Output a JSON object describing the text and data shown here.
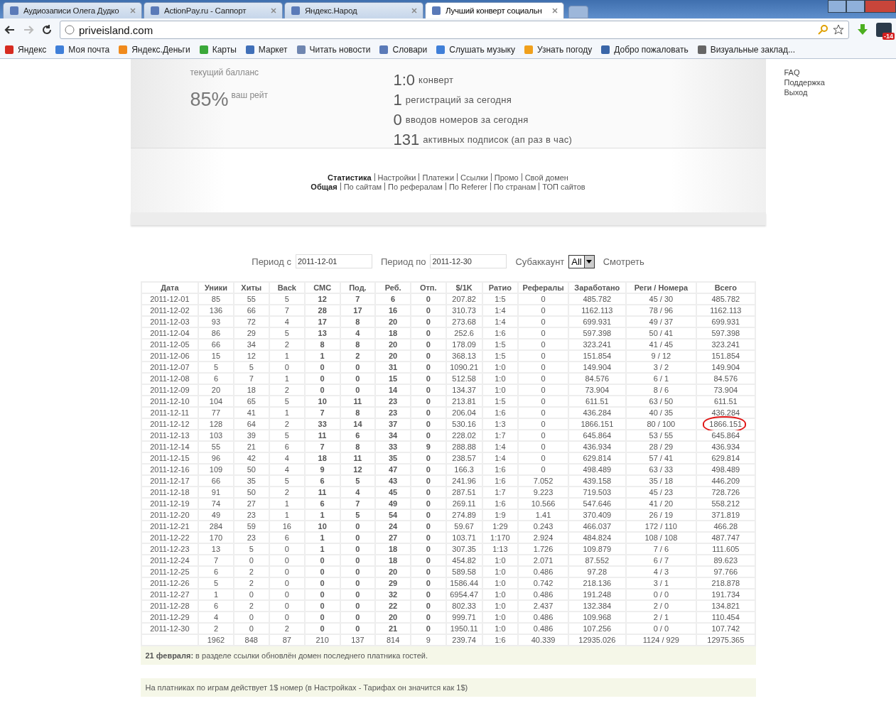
{
  "browser": {
    "tabs": [
      {
        "label": "Аудиозаписи Олега Дудко",
        "selected": false
      },
      {
        "label": "ActionPay.ru - Саппорт",
        "selected": false
      },
      {
        "label": "Яндекс.Народ",
        "selected": false
      },
      {
        "label": "Лучший конверт социальн",
        "selected": true
      }
    ],
    "address": "priveisland.com",
    "badge": "-14",
    "bookmarks": [
      {
        "label": "Яндекс",
        "color": "#d62b20"
      },
      {
        "label": "Моя почта",
        "color": "#3f7fd8"
      },
      {
        "label": "Яндекс.Деньги",
        "color": "#f08a1c"
      },
      {
        "label": "Карты",
        "color": "#3aa83a"
      },
      {
        "label": "Маркет",
        "color": "#3f6fb8"
      },
      {
        "label": "Читать новости",
        "color": "#6f86b0"
      },
      {
        "label": "Словари",
        "color": "#5a7ab8"
      },
      {
        "label": "Слушать музыку",
        "color": "#3f7fd8"
      },
      {
        "label": "Узнать погоду",
        "color": "#f0a01c"
      },
      {
        "label": "Добро пожаловать",
        "color": "#3a66a8"
      },
      {
        "label": "Визуальные заклад...",
        "color": "#666666"
      }
    ]
  },
  "header": {
    "balance_label": "текущий балланс",
    "rate": "85%",
    "rate_label": "ваш рейт",
    "stats": [
      {
        "value": "1:0",
        "label": "конверт"
      },
      {
        "value": "1",
        "label": "регистраций за сегодня"
      },
      {
        "value": "0",
        "label": "вводов номеров за сегодня"
      },
      {
        "value": "131",
        "label": "активных подписок (ап раз в час)"
      }
    ],
    "links": [
      "FAQ",
      "Поддержка",
      "Выход"
    ]
  },
  "nav": {
    "primary": [
      {
        "label": "Статистика",
        "selected": true
      },
      {
        "label": "Настройки",
        "selected": false
      },
      {
        "label": "Платежи",
        "selected": false
      },
      {
        "label": "Ссылки",
        "selected": false
      },
      {
        "label": "Промо",
        "selected": false
      },
      {
        "label": "Свой домен",
        "selected": false
      }
    ],
    "secondary": [
      {
        "label": "Общая",
        "selected": true
      },
      {
        "label": "По сайтам",
        "selected": false
      },
      {
        "label": "По рефералам",
        "selected": false
      },
      {
        "label": "По Referer",
        "selected": false
      },
      {
        "label": "По странам",
        "selected": false
      },
      {
        "label": "ТОП сайтов",
        "selected": false
      }
    ]
  },
  "filters": {
    "from_label": "Период с",
    "from": "2011-12-01",
    "to_label": "Период по",
    "to": "2011-12-30",
    "sub_label": "Субаккаунт",
    "sub": "All",
    "submit": "Смотреть"
  },
  "table": {
    "columns": [
      {
        "label": "Дата",
        "bold": false
      },
      {
        "label": "Уники",
        "bold": false
      },
      {
        "label": "Хиты",
        "bold": false
      },
      {
        "label": "Back",
        "bold": false
      },
      {
        "label": "СМС",
        "bold": true
      },
      {
        "label": "Под.",
        "bold": true
      },
      {
        "label": "Реб.",
        "bold": true
      },
      {
        "label": "Отп.",
        "bold": true
      },
      {
        "label": "$/1K",
        "bold": false
      },
      {
        "label": "Ратио",
        "bold": false
      },
      {
        "label": "Рефералы",
        "bold": false
      },
      {
        "label": "Заработано",
        "bold": false
      },
      {
        "label": "Реги / Номера",
        "bold": false
      },
      {
        "label": "Всего",
        "bold": false
      }
    ],
    "rows": [
      {
        "cells": [
          "2011-12-01",
          "85",
          "55",
          "5",
          "12",
          "7",
          "6",
          "0",
          "207.82",
          "1:5",
          "0",
          "485.782",
          "45 / 30",
          "485.782"
        ],
        "circled": false
      },
      {
        "cells": [
          "2011-12-02",
          "136",
          "66",
          "7",
          "28",
          "17",
          "16",
          "0",
          "310.73",
          "1:4",
          "0",
          "1162.113",
          "78 / 96",
          "1162.113"
        ],
        "circled": false
      },
      {
        "cells": [
          "2011-12-03",
          "93",
          "72",
          "4",
          "17",
          "8",
          "20",
          "0",
          "273.68",
          "1:4",
          "0",
          "699.931",
          "49 / 37",
          "699.931"
        ],
        "circled": false
      },
      {
        "cells": [
          "2011-12-04",
          "86",
          "29",
          "5",
          "13",
          "4",
          "18",
          "0",
          "252.6",
          "1:6",
          "0",
          "597.398",
          "50 / 41",
          "597.398"
        ],
        "circled": false
      },
      {
        "cells": [
          "2011-12-05",
          "66",
          "34",
          "2",
          "8",
          "8",
          "20",
          "0",
          "178.09",
          "1:5",
          "0",
          "323.241",
          "41 / 45",
          "323.241"
        ],
        "circled": false
      },
      {
        "cells": [
          "2011-12-06",
          "15",
          "12",
          "1",
          "1",
          "2",
          "20",
          "0",
          "368.13",
          "1:5",
          "0",
          "151.854",
          "9 / 12",
          "151.854"
        ],
        "circled": false
      },
      {
        "cells": [
          "2011-12-07",
          "5",
          "5",
          "0",
          "0",
          "0",
          "31",
          "0",
          "1090.21",
          "1:0",
          "0",
          "149.904",
          "3 / 2",
          "149.904"
        ],
        "circled": false
      },
      {
        "cells": [
          "2011-12-08",
          "6",
          "7",
          "1",
          "0",
          "0",
          "15",
          "0",
          "512.58",
          "1:0",
          "0",
          "84.576",
          "6 / 1",
          "84.576"
        ],
        "circled": false
      },
      {
        "cells": [
          "2011-12-09",
          "20",
          "18",
          "2",
          "0",
          "0",
          "14",
          "0",
          "134.37",
          "1:0",
          "0",
          "73.904",
          "8 / 6",
          "73.904"
        ],
        "circled": false
      },
      {
        "cells": [
          "2011-12-10",
          "104",
          "65",
          "5",
          "10",
          "11",
          "23",
          "0",
          "213.81",
          "1:5",
          "0",
          "611.51",
          "63 / 50",
          "611.51"
        ],
        "circled": false
      },
      {
        "cells": [
          "2011-12-11",
          "77",
          "41",
          "1",
          "7",
          "8",
          "23",
          "0",
          "206.04",
          "1:6",
          "0",
          "436.284",
          "40 / 35",
          "436.284"
        ],
        "circled": false
      },
      {
        "cells": [
          "2011-12-12",
          "128",
          "64",
          "2",
          "33",
          "14",
          "37",
          "0",
          "530.16",
          "1:3",
          "0",
          "1866.151",
          "80 / 100",
          "1866.151"
        ],
        "circled": true
      },
      {
        "cells": [
          "2011-12-13",
          "103",
          "39",
          "5",
          "11",
          "6",
          "34",
          "0",
          "228.02",
          "1:7",
          "0",
          "645.864",
          "53 / 55",
          "645.864"
        ],
        "circled": false
      },
      {
        "cells": [
          "2011-12-14",
          "55",
          "21",
          "6",
          "7",
          "8",
          "33",
          "9",
          "288.88",
          "1:4",
          "0",
          "436.934",
          "28 / 29",
          "436.934"
        ],
        "circled": false
      },
      {
        "cells": [
          "2011-12-15",
          "96",
          "42",
          "4",
          "18",
          "11",
          "35",
          "0",
          "238.57",
          "1:4",
          "0",
          "629.814",
          "57 / 41",
          "629.814"
        ],
        "circled": false
      },
      {
        "cells": [
          "2011-12-16",
          "109",
          "50",
          "4",
          "9",
          "12",
          "47",
          "0",
          "166.3",
          "1:6",
          "0",
          "498.489",
          "63 / 33",
          "498.489"
        ],
        "circled": false
      },
      {
        "cells": [
          "2011-12-17",
          "66",
          "35",
          "5",
          "6",
          "5",
          "43",
          "0",
          "241.96",
          "1:6",
          "7.052",
          "439.158",
          "35 / 18",
          "446.209"
        ],
        "circled": false
      },
      {
        "cells": [
          "2011-12-18",
          "91",
          "50",
          "2",
          "11",
          "4",
          "45",
          "0",
          "287.51",
          "1:7",
          "9.223",
          "719.503",
          "45 / 23",
          "728.726"
        ],
        "circled": false
      },
      {
        "cells": [
          "2011-12-19",
          "74",
          "27",
          "1",
          "6",
          "7",
          "49",
          "0",
          "269.11",
          "1:6",
          "10.566",
          "547.646",
          "41 / 20",
          "558.212"
        ],
        "circled": false
      },
      {
        "cells": [
          "2011-12-20",
          "49",
          "23",
          "1",
          "1",
          "5",
          "54",
          "0",
          "274.89",
          "1:9",
          "1.41",
          "370.409",
          "26 / 19",
          "371.819"
        ],
        "circled": false
      },
      {
        "cells": [
          "2011-12-21",
          "284",
          "59",
          "16",
          "10",
          "0",
          "24",
          "0",
          "59.67",
          "1:29",
          "0.243",
          "466.037",
          "172 / 110",
          "466.28"
        ],
        "circled": false
      },
      {
        "cells": [
          "2011-12-22",
          "170",
          "23",
          "6",
          "1",
          "0",
          "27",
          "0",
          "103.71",
          "1:170",
          "2.924",
          "484.824",
          "108 / 108",
          "487.747"
        ],
        "circled": false
      },
      {
        "cells": [
          "2011-12-23",
          "13",
          "5",
          "0",
          "1",
          "0",
          "18",
          "0",
          "307.35",
          "1:13",
          "1.726",
          "109.879",
          "7 / 6",
          "111.605"
        ],
        "circled": false
      },
      {
        "cells": [
          "2011-12-24",
          "7",
          "0",
          "0",
          "0",
          "0",
          "18",
          "0",
          "454.82",
          "1:0",
          "2.071",
          "87.552",
          "6 / 7",
          "89.623"
        ],
        "circled": false
      },
      {
        "cells": [
          "2011-12-25",
          "6",
          "2",
          "0",
          "0",
          "0",
          "20",
          "0",
          "589.58",
          "1:0",
          "0.486",
          "97.28",
          "4 / 3",
          "97.766"
        ],
        "circled": false
      },
      {
        "cells": [
          "2011-12-26",
          "5",
          "2",
          "0",
          "0",
          "0",
          "29",
          "0",
          "1586.44",
          "1:0",
          "0.742",
          "218.136",
          "3 / 1",
          "218.878"
        ],
        "circled": false
      },
      {
        "cells": [
          "2011-12-27",
          "1",
          "0",
          "0",
          "0",
          "0",
          "32",
          "0",
          "6954.47",
          "1:0",
          "0.486",
          "191.248",
          "0 / 0",
          "191.734"
        ],
        "circled": false
      },
      {
        "cells": [
          "2011-12-28",
          "6",
          "2",
          "0",
          "0",
          "0",
          "22",
          "0",
          "802.33",
          "1:0",
          "2.437",
          "132.384",
          "2 / 0",
          "134.821"
        ],
        "circled": false
      },
      {
        "cells": [
          "2011-12-29",
          "4",
          "0",
          "0",
          "0",
          "0",
          "20",
          "0",
          "999.71",
          "1:0",
          "0.486",
          "109.968",
          "2 / 1",
          "110.454"
        ],
        "circled": false
      },
      {
        "cells": [
          "2011-12-30",
          "2",
          "0",
          "2",
          "0",
          "0",
          "21",
          "0",
          "1950.11",
          "1:0",
          "0.486",
          "107.256",
          "0 / 0",
          "107.742"
        ],
        "circled": false
      }
    ],
    "totals": [
      "1962",
      "848",
      "87",
      "210",
      "137",
      "814",
      "9",
      "239.74",
      "1:6",
      "40.339",
      "12935.026",
      "1124 / 929",
      "12975.365"
    ]
  },
  "notices": [
    "**21 февраля:** в разделе ссылки обновлён домен последнего платника гостей.",
    "На платниках по играм действует 1$ номер (в Настройках - Тарифах он значится как 1$)"
  ]
}
